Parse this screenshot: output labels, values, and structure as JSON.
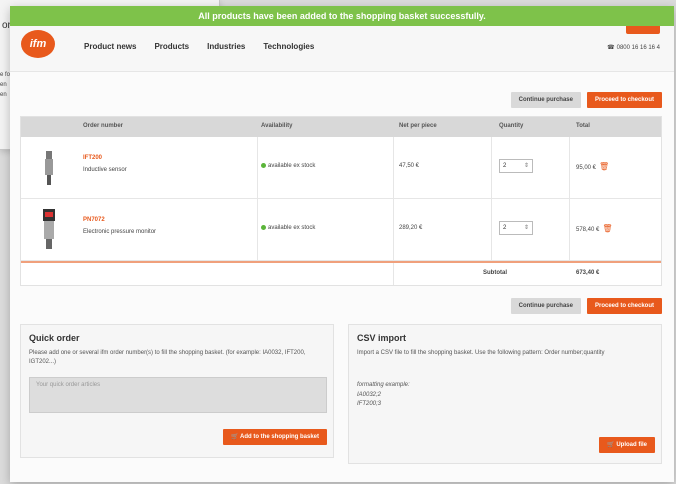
{
  "background_window": {
    "title": "or",
    "lines": [
      "e fo",
      "en",
      "en"
    ]
  },
  "banner": {
    "text": "All products have been added to the shopping basket successfully."
  },
  "header": {
    "logo": "ifm",
    "nav": [
      "Product news",
      "Products",
      "Industries",
      "Technologies"
    ],
    "phone": "0800 16 16 16 4"
  },
  "actions": {
    "continue": "Continue purchase",
    "checkout": "Proceed to checkout"
  },
  "table": {
    "headers": [
      "Order number",
      "Availability",
      "Net per piece",
      "Quantity",
      "Total"
    ],
    "rows": [
      {
        "code": "IFT200",
        "name": "Inductive sensor",
        "availability": "available ex stock",
        "price": "47,50 €",
        "quantity": "2",
        "total": "95,00 €"
      },
      {
        "code": "PN7072",
        "name": "Electronic pressure monitor",
        "availability": "available ex stock",
        "price": "289,20 €",
        "quantity": "2",
        "total": "578,40 €"
      }
    ],
    "subtotal_label": "Subtotal",
    "subtotal_value": "673,40 €"
  },
  "quick_order": {
    "title": "Quick order",
    "description": "Please add one or several ifm order number(s) to fill the shopping basket. (for example: IA0032, IFT200, IGT202...)",
    "placeholder": "Your quick order articles",
    "button": "🛒 Add to the shopping basket"
  },
  "csv_import": {
    "title": "CSV import",
    "description": "Import a CSV file to fill the shopping basket. Use the following pattern: Order number;quantity",
    "example_label": "formatting example:",
    "example_lines": [
      "IA0032;2",
      "IFT200;3"
    ],
    "button": "🛒 Upload file"
  },
  "colors": {
    "accent": "#e8591c",
    "success": "#7ec24a"
  }
}
